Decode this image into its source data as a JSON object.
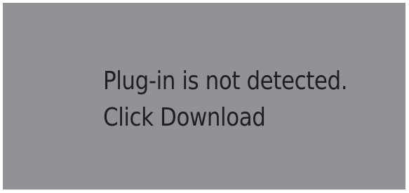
{
  "plugin_notice": {
    "line1": "Plug-in is not detected.",
    "line2": "Click Download"
  },
  "colors": {
    "panel_background": "#929296",
    "text": "#1f1f22",
    "page_background": "#ffffff"
  }
}
